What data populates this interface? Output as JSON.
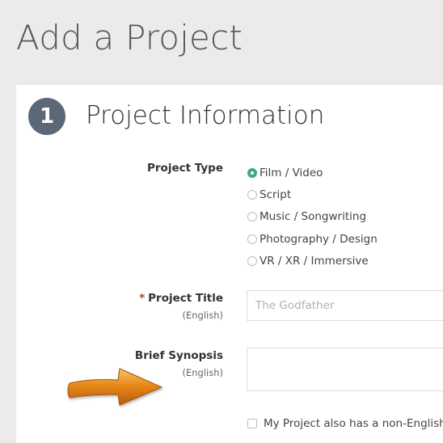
{
  "page": {
    "title": "Add a Project"
  },
  "section": {
    "step_number": "1",
    "title": "Project Information"
  },
  "project_type": {
    "label": "Project Type",
    "options": [
      {
        "label": "Film / Video",
        "selected": true
      },
      {
        "label": "Script",
        "selected": false
      },
      {
        "label": "Music / Songwriting",
        "selected": false
      },
      {
        "label": "Photography / Design",
        "selected": false
      },
      {
        "label": "VR / XR / Immersive",
        "selected": false
      }
    ]
  },
  "project_title": {
    "required_mark": "*",
    "label": "Project Title",
    "sublabel": "(English)",
    "placeholder": "The Godfather",
    "value": ""
  },
  "brief_synopsis": {
    "label": "Brief Synopsis",
    "sublabel": "(English)",
    "value": ""
  },
  "non_english_checkbox": {
    "label": "My Project also has a non-English T",
    "checked": false
  },
  "colors": {
    "accent": "#3daa7a",
    "badge": "#5b6878",
    "required": "#c0392b",
    "arrow": "#e8891a"
  },
  "icons": {
    "annotation": "arrow-right-icon"
  }
}
